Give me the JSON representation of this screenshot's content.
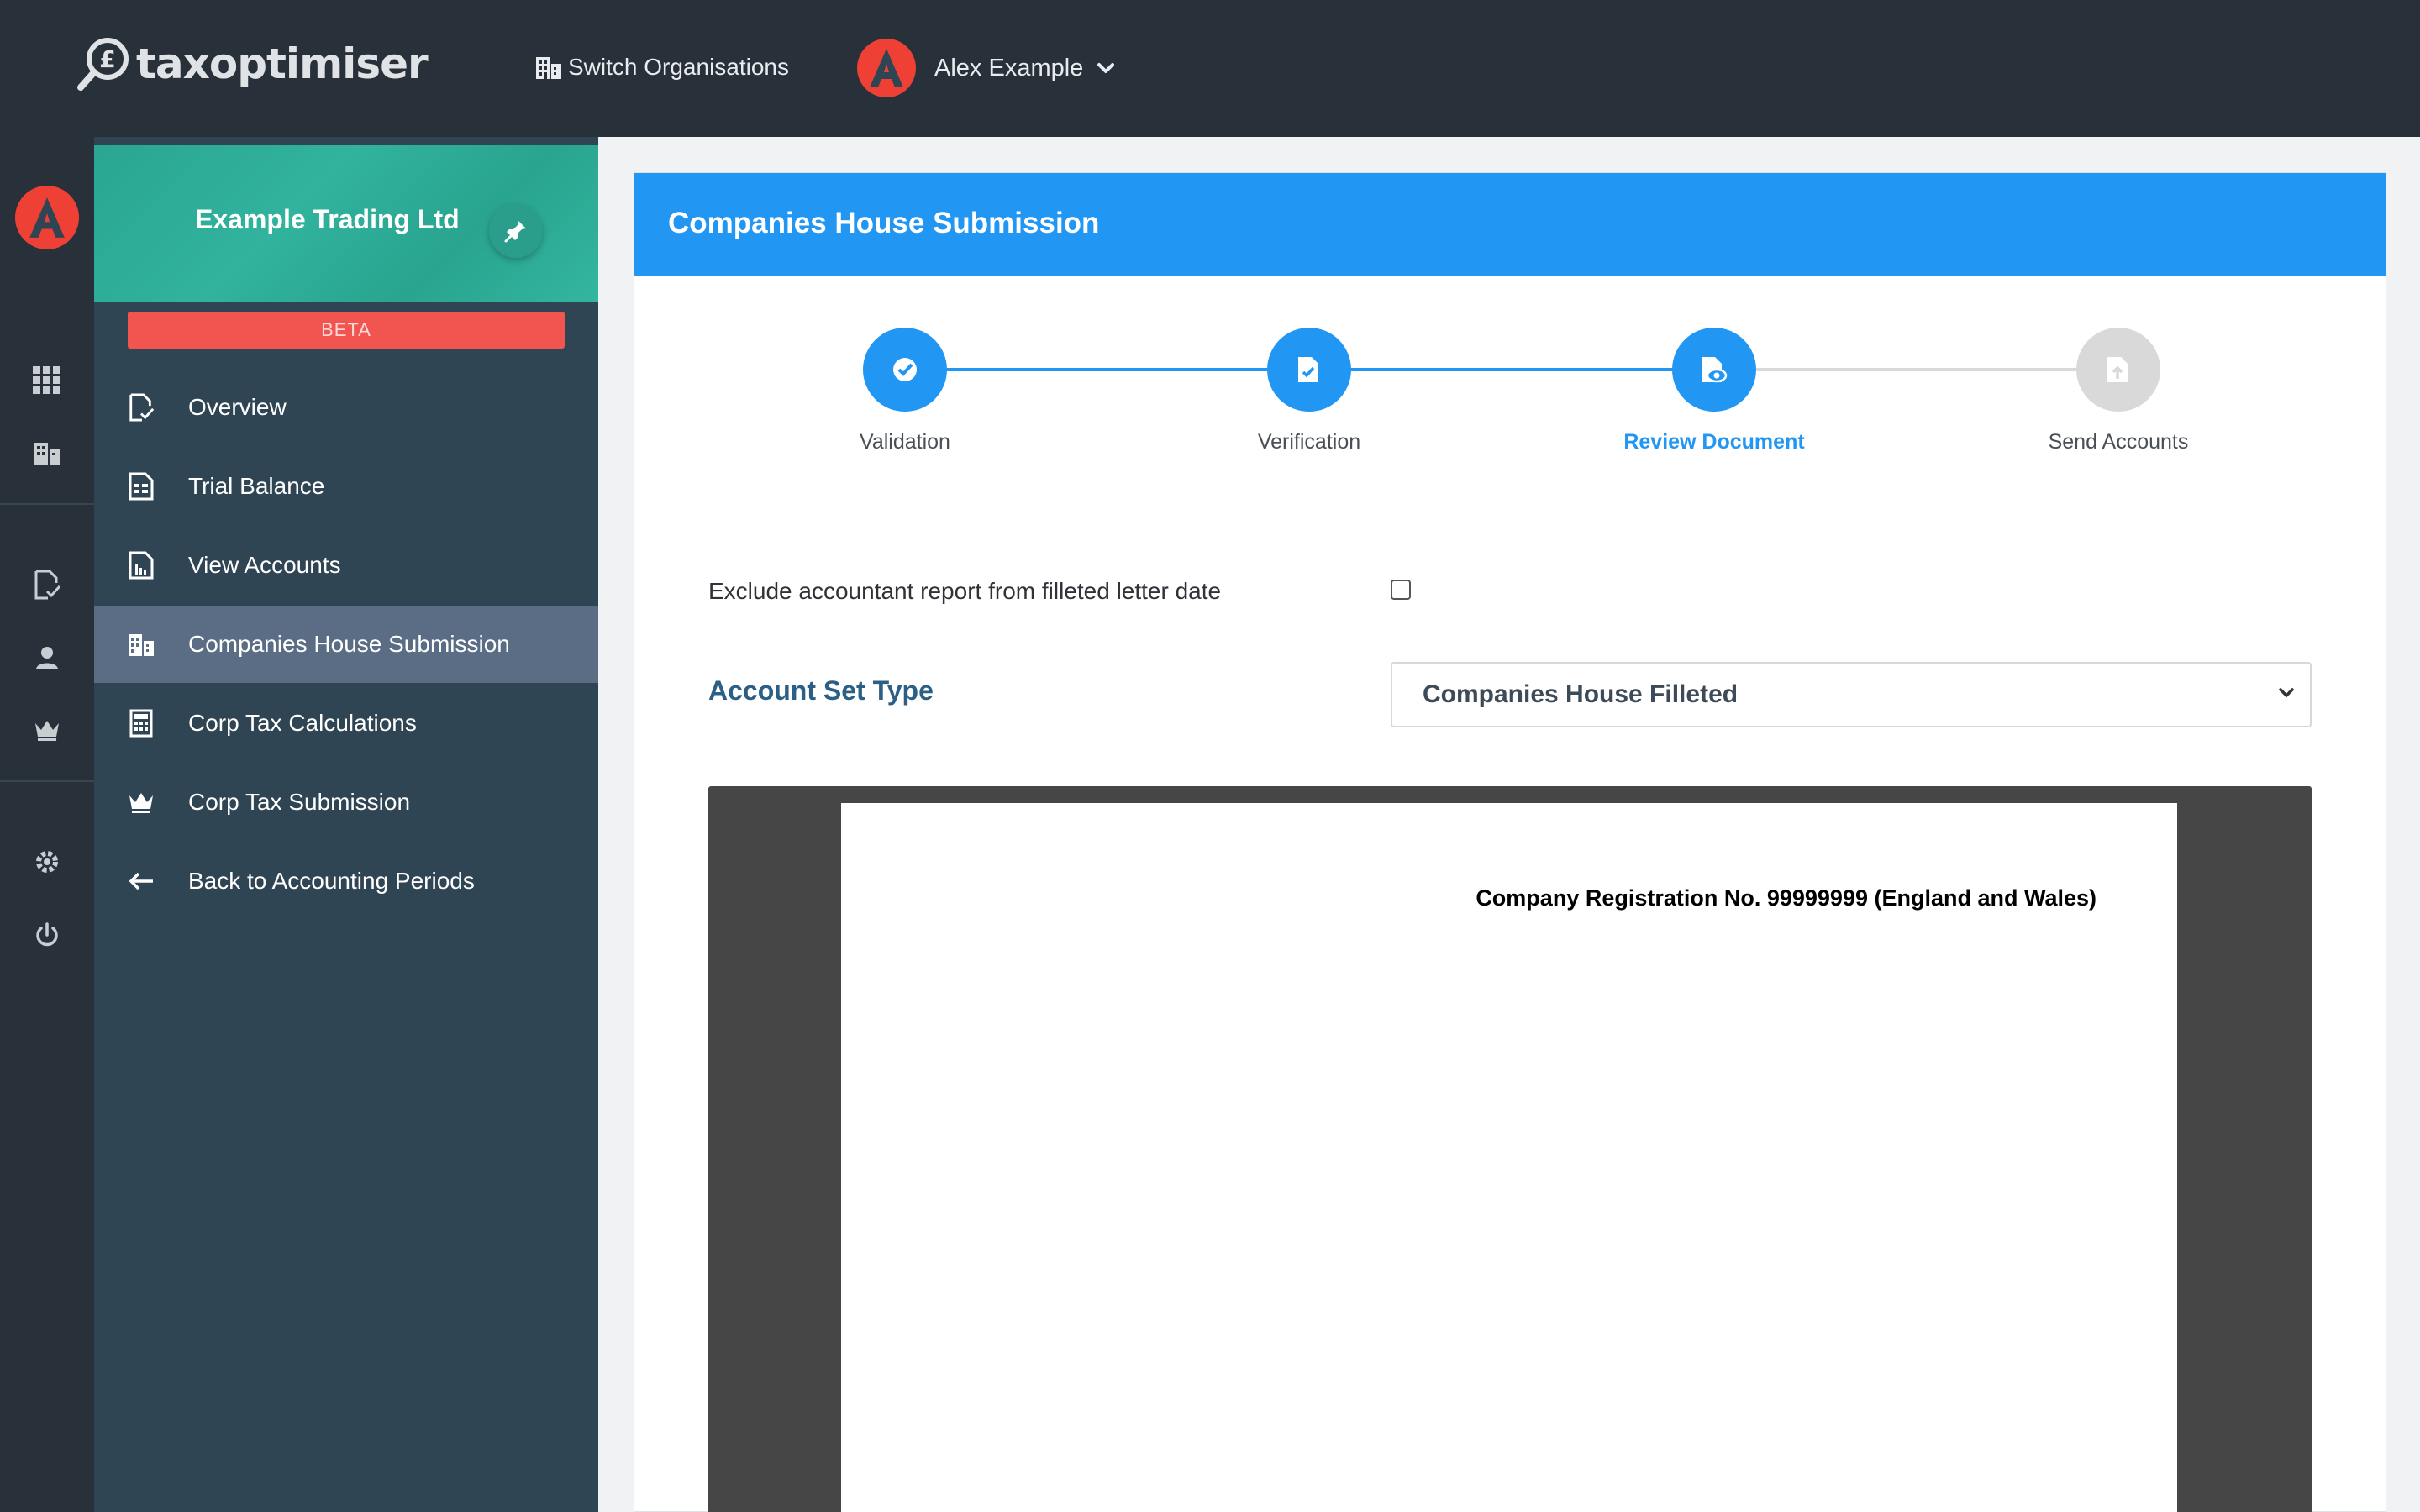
{
  "app": {
    "logo_text": "taxoptimiser",
    "switch_org_label": "Switch Organisations",
    "user_name": "Alex Example",
    "avatar_letter": "A"
  },
  "sidebar": {
    "org_name": "Example Trading Ltd",
    "beta_label": "BETA",
    "items": [
      {
        "label": "Overview",
        "icon": "document-check-icon"
      },
      {
        "label": "Trial Balance",
        "icon": "spreadsheet-icon"
      },
      {
        "label": "View Accounts",
        "icon": "report-chart-icon"
      },
      {
        "label": "Companies House Submission",
        "icon": "building-icon",
        "active": true
      },
      {
        "label": "Corp Tax Calculations",
        "icon": "calculator-icon"
      },
      {
        "label": "Corp Tax Submission",
        "icon": "crown-icon"
      },
      {
        "label": "Back to Accounting Periods",
        "icon": "arrow-left-icon"
      }
    ]
  },
  "main": {
    "title": "Companies House Submission",
    "steps": [
      {
        "label": "Validation",
        "state": "complete"
      },
      {
        "label": "Verification",
        "state": "complete"
      },
      {
        "label": "Review Document",
        "state": "active"
      },
      {
        "label": "Send Accounts",
        "state": "pending"
      }
    ],
    "exclude_label": "Exclude accountant report from filleted letter date",
    "exclude_checked": false,
    "account_set_label": "Account Set Type",
    "account_set_value": "Companies House Filleted",
    "document_text": "Company Registration No. 99999999 (England and Wales)"
  },
  "colors": {
    "topbar": "#28313a",
    "sidebar": "#2f4553",
    "accent": "#2196f3",
    "teal": "#2aa692",
    "beta": "#f25450",
    "avatar": "#ef4035"
  }
}
